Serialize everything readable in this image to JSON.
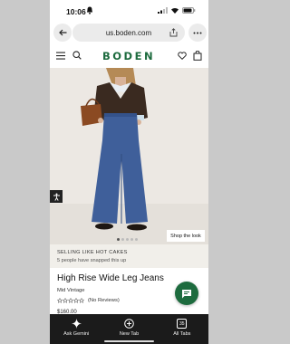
{
  "status": {
    "time": "10:06"
  },
  "browser": {
    "url": "us.boden.com",
    "bottom_tabs": [
      {
        "label": "Ask Gemini",
        "icon": "sparkle-icon"
      },
      {
        "label": "New Tab",
        "icon": "plus-circle-icon"
      },
      {
        "label": "All Tabs",
        "icon": "tabs-count-icon",
        "count": "35"
      }
    ]
  },
  "site": {
    "logo": "BODEN",
    "hero": {
      "shop_the_look": "Shop the look",
      "slides_total": 5,
      "active_slide": 0
    },
    "banner": {
      "title": "SELLING LIKE HOT CAKES",
      "subtitle": "5 people have snapped this up"
    },
    "product": {
      "name": "High Rise Wide Leg Jeans",
      "subtitle": "Mid Vintage",
      "reviews": "(No Reviews)",
      "price": "$160.00",
      "rating": 0
    }
  },
  "colors": {
    "brand": "#1d6b3e",
    "bottom_bar": "#1b1b1b"
  }
}
